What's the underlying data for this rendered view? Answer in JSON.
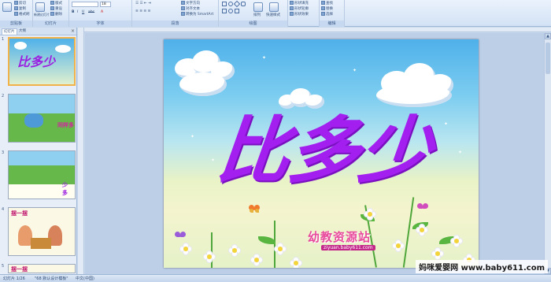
{
  "ribbon": {
    "groups": [
      {
        "label": "剪贴板",
        "items": [
          "剪切",
          "复制",
          "格式刷"
        ]
      },
      {
        "label": "幻灯片",
        "items": [
          "新建幻灯片",
          "版式",
          "重设",
          "删除"
        ]
      },
      {
        "label": "字体",
        "items": [
          "18"
        ]
      },
      {
        "label": "段落",
        "items": [
          "文字方向",
          "对齐文本",
          "转换为 SmartArt"
        ]
      },
      {
        "label": "绘图",
        "items": [
          "排列",
          "快速样式"
        ]
      },
      {
        "label": "编辑",
        "items": [
          "查找",
          "替换",
          "选择"
        ]
      },
      {
        "label": "",
        "items": [
          "形状填充",
          "形状轮廓",
          "形状效果"
        ]
      }
    ]
  },
  "left_panel": {
    "tabs": [
      "幻灯片",
      "大纲"
    ],
    "thumbnails": [
      {
        "num": "1",
        "text": "比多少"
      },
      {
        "num": "2",
        "text": "同样多"
      },
      {
        "num": "3",
        "text": "少 多"
      },
      {
        "num": "4",
        "text": "摆一摆"
      },
      {
        "num": "5",
        "text": "摆一摆"
      }
    ]
  },
  "slide": {
    "title": "比多少",
    "logo_text": "幼教资源站",
    "logo_url": "ziyuan.baby611.com"
  },
  "status": {
    "slide_info": "幻灯片 1/26",
    "theme": "\"68 默认设计模板\"",
    "language": "中文(中国)"
  },
  "watermark": "妈咪爱婴网 www.baby611.com",
  "colors": {
    "title": "#a31ff0",
    "ribbon_bg": "#d3e2f5",
    "sky_top": "#4fb1ea"
  }
}
